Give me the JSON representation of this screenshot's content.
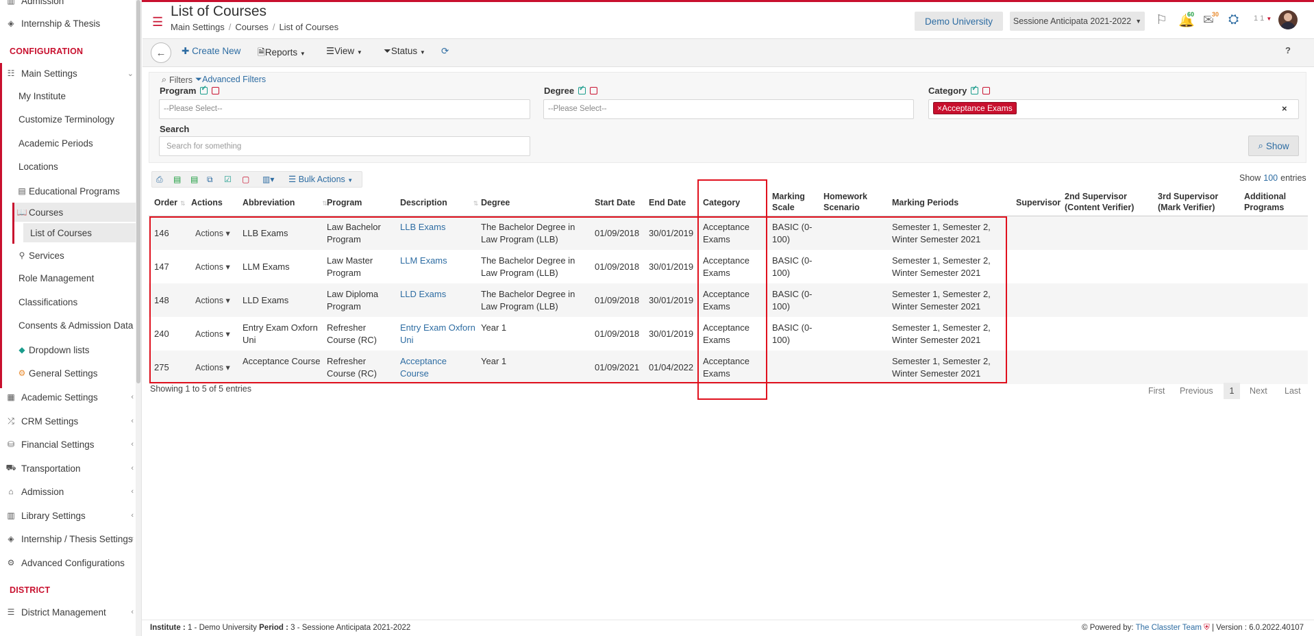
{
  "sidebar": {
    "top_partial": "Admission",
    "internship_thesis": "Internship & Thesis",
    "section_configuration": "CONFIGURATION",
    "main_settings": "Main Settings",
    "sub": [
      "My Institute",
      "Customize Terminology",
      "Academic Periods",
      "Locations"
    ],
    "educational_programs": "Educational Programs",
    "courses": "Courses",
    "list_of_courses": "List of Courses",
    "services": "Services",
    "sub2": [
      "Role Management",
      "Classifications",
      "Consents & Admission Data"
    ],
    "dropdown_lists": "Dropdown lists",
    "general_settings": "General Settings",
    "groups": [
      "Academic Settings",
      "CRM Settings",
      "Financial Settings",
      "Transportation",
      "Admission",
      "Library Settings",
      "Internship / Thesis Settings",
      "Advanced Configurations"
    ],
    "section_district": "DISTRICT",
    "district_management": "District Management"
  },
  "header": {
    "title": "List of Courses",
    "breadcrumb": [
      "Main Settings",
      "Courses",
      "List of Courses"
    ],
    "university": "Demo University",
    "session": "Sessione Anticipata 2021-2022",
    "notif_count": "60",
    "mail_count": "30",
    "user": "1 1"
  },
  "toolbar": {
    "create_new": "Create New",
    "reports": "Reports",
    "view": "View",
    "status": "Status",
    "help": "?"
  },
  "filters": {
    "title": "Filters",
    "advanced": "Advanced Filters",
    "program_label": "Program",
    "program_placeholder": "--Please Select--",
    "degree_label": "Degree",
    "degree_placeholder": "--Please Select--",
    "category_label": "Category",
    "category_tag": "Acceptance Exams",
    "search_label": "Search",
    "search_placeholder": "Search for something",
    "show_button": "Show"
  },
  "table_tools": {
    "bulk_actions": "Bulk Actions",
    "show_label": "Show",
    "show_count": "100",
    "entries_label": "entries"
  },
  "table": {
    "columns": [
      "Order",
      "Actions",
      "Abbreviation",
      "Program",
      "Description",
      "Degree",
      "Start Date",
      "End Date",
      "Category",
      "Marking Scale",
      "Homework Scenario",
      "Marking Periods",
      "Supervisor",
      "2nd Supervisor (Content Verifier)",
      "3rd Supervisor (Mark Verifier)",
      "Additional Programs"
    ],
    "rows": [
      {
        "order": "146",
        "actions": "Actions",
        "abbr": "LLB Exams",
        "program": "Law Bachelor Program",
        "description": "LLB Exams",
        "degree": "The Bachelor Degree in Law Program (LLB)",
        "start": "01/09/2018",
        "end": "30/01/2019",
        "category": "Acceptance Exams",
        "scale": "BASIC (0-100)",
        "periods": "Semester 1, Semester 2, Winter Semester 2021"
      },
      {
        "order": "147",
        "actions": "Actions",
        "abbr": "LLM Exams",
        "program": "Law Master Program",
        "description": "LLM Exams",
        "degree": "The Bachelor Degree in Law Program (LLB)",
        "start": "01/09/2018",
        "end": "30/01/2019",
        "category": "Acceptance Exams",
        "scale": "BASIC (0-100)",
        "periods": "Semester 1, Semester 2, Winter Semester 2021"
      },
      {
        "order": "148",
        "actions": "Actions",
        "abbr": "LLD Exams",
        "program": "Law Diploma Program",
        "description": "LLD Exams",
        "degree": "The Bachelor Degree in Law Program (LLB)",
        "start": "01/09/2018",
        "end": "30/01/2019",
        "category": "Acceptance Exams",
        "scale": "BASIC (0-100)",
        "periods": "Semester 1, Semester 2, Winter Semester 2021"
      },
      {
        "order": "240",
        "actions": "Actions",
        "abbr": "Entry Exam Oxforn Uni",
        "program": "Refresher Course (RC)",
        "description": "Entry Exam Oxforn Uni",
        "degree": "Year 1",
        "start": "01/09/2018",
        "end": "30/01/2019",
        "category": "Acceptance Exams",
        "scale": "BASIC (0-100)",
        "periods": "Semester 1, Semester 2, Winter Semester 2021"
      },
      {
        "order": "275",
        "actions": "Actions",
        "abbr": "Acceptance Course",
        "program": "Refresher Course (RC)",
        "description": "Acceptance Course",
        "degree": "Year 1",
        "start": "01/09/2021",
        "end": "01/04/2022",
        "category": "Acceptance Exams",
        "scale": "",
        "periods": "Semester 1, Semester 2, Winter Semester 2021"
      }
    ],
    "showing": "Showing 1 to 5 of 5 entries",
    "pager": {
      "first": "First",
      "previous": "Previous",
      "current": "1",
      "next": "Next",
      "last": "Last"
    }
  },
  "footer": {
    "institute_label": "Institute :",
    "institute_value": "1 - Demo University",
    "period_label": "Period :",
    "period_value": "3 - Sessione Anticipata 2021-2022",
    "powered": "Powered by:",
    "team": "The Classter Team",
    "version": "| Version : 6.0.2022.40107"
  },
  "colors": {
    "accent": "#c8102e",
    "link": "#2d6ca2",
    "highlight": "#e0101d"
  }
}
